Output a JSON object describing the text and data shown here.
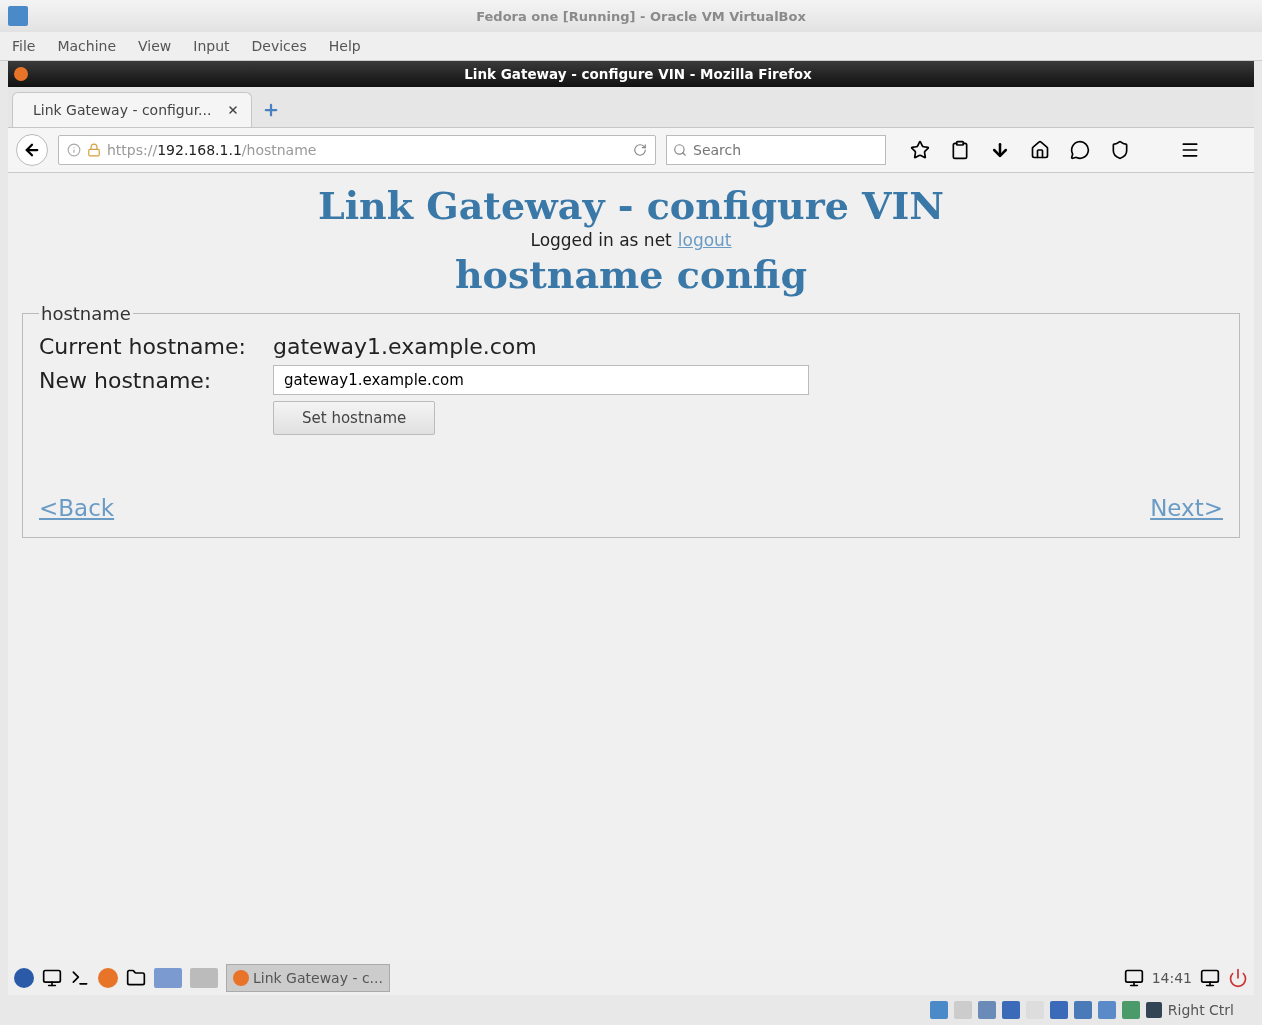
{
  "host_window": {
    "title": "Fedora one [Running] - Oracle VM VirtualBox",
    "menu": [
      "File",
      "Machine",
      "View",
      "Input",
      "Devices",
      "Help"
    ]
  },
  "browser": {
    "title": "Link Gateway - configure VIN - Mozilla Firefox",
    "tabs": [
      {
        "label": "Link Gateway - configur...",
        "selected": true
      }
    ],
    "url": {
      "scheme": "https://",
      "host": "192.168.1.1",
      "path": "/hostname"
    },
    "search": {
      "placeholder": "Search"
    }
  },
  "page": {
    "heading": "Link Gateway - configure VIN",
    "login_text": "Logged in as net",
    "logout_link": "logout",
    "subheading": "hostname config",
    "fieldset": {
      "legend": "hostname",
      "current_label": "Current hostname:",
      "current_value": "gateway1.example.com",
      "new_label": "New hostname:",
      "new_value": "gateway1.example.com",
      "button": "Set hostname"
    },
    "back_link": "<Back",
    "next_link": "Next>"
  },
  "taskbar": {
    "task": "Link Gateway - c...",
    "clock": "14:41"
  },
  "status_bar": {
    "host_key": "Right Ctrl"
  }
}
